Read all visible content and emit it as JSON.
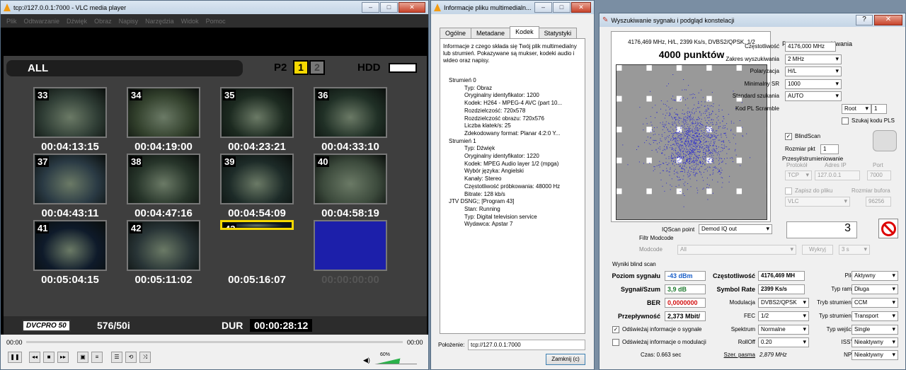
{
  "vlc": {
    "title": "tcp://127.0.0.1:7000 - VLC media player",
    "menu": [
      "Plik",
      "Odtwarzanie",
      "Dźwięk",
      "Obraz",
      "Napisy",
      "Narzędzia",
      "Widok",
      "Pomoc"
    ],
    "all_label": "ALL",
    "p2_label": "P2",
    "slot1": "1",
    "slot2": "2",
    "hdd_label": "HDD",
    "clips": [
      {
        "num": "33",
        "tc": "00:04:13:15"
      },
      {
        "num": "34",
        "tc": "00:04:19:00"
      },
      {
        "num": "35",
        "tc": "00:04:23:21"
      },
      {
        "num": "36",
        "tc": "00:04:33:10"
      },
      {
        "num": "37",
        "tc": "00:04:43:11"
      },
      {
        "num": "38",
        "tc": "00:04:47:16"
      },
      {
        "num": "39",
        "tc": "00:04:54:09"
      },
      {
        "num": "40",
        "tc": "00:04:58:19"
      },
      {
        "num": "41",
        "tc": "00:05:04:15"
      },
      {
        "num": "42",
        "tc": "00:05:11:02"
      },
      {
        "num": "43",
        "tc": "00:05:16:07"
      },
      {
        "num": "",
        "tc": "00:00:00:00"
      }
    ],
    "dvcpro": "DVCPRO 50",
    "format": "576/50i",
    "dur_label": "DUR",
    "dur_value": "00:00:28:12",
    "time_left": "00:00",
    "time_right": "00:00",
    "volume": "60%"
  },
  "info": {
    "title": "Informacje pliku multimedialn...",
    "tabs": [
      "Ogólne",
      "Metadane",
      "Kodek",
      "Statystyki"
    ],
    "active_tab": "Kodek",
    "desc": "Informacje z czego składa się Twój plik multimedialny lub strumień. Pokazywane są mukser, kodeki audio i wideo oraz napisy.",
    "tree": [
      {
        "t": "h",
        "v": "Strumień 0"
      },
      {
        "t": "c",
        "v": "Typ: Obraz"
      },
      {
        "t": "c",
        "v": "Oryginalny identyfikator: 1200"
      },
      {
        "t": "c",
        "v": "Kodek: H264 - MPEG-4 AVC (part 10..."
      },
      {
        "t": "c",
        "v": "Rozdzielczość: 720x578"
      },
      {
        "t": "c",
        "v": "Rozdzielczość obrazu: 720x576"
      },
      {
        "t": "c",
        "v": "Liczba klatek/s: 25"
      },
      {
        "t": "c",
        "v": "Zdekodowany format: Planar 4:2:0 Y..."
      },
      {
        "t": "h",
        "v": "Strumień 1"
      },
      {
        "t": "c",
        "v": "Typ: Dźwięk"
      },
      {
        "t": "c",
        "v": "Oryginalny identyfikator: 1220"
      },
      {
        "t": "c",
        "v": "Kodek: MPEG Audio layer 1/2 (mpga)"
      },
      {
        "t": "c",
        "v": "Wybór języka: Angielski"
      },
      {
        "t": "c",
        "v": "Kanały: Stereo"
      },
      {
        "t": "c",
        "v": "Częstotliwość próbkowania: 48000 Hz"
      },
      {
        "t": "c",
        "v": "Bitrate: 128 kb/s"
      },
      {
        "t": "h",
        "v": "JTV DSNG;; [Program 43]"
      },
      {
        "t": "c",
        "v": "Stan: Running"
      },
      {
        "t": "c",
        "v": "Typ: Digital television service"
      },
      {
        "t": "c",
        "v": "Wydawca: Apstar 7"
      }
    ],
    "loc_label": "Położenie:",
    "loc_value": "tcp://127.0.0.1:7000",
    "close_label": "Zamknij (c)"
  },
  "scan": {
    "title": "Wyszukiwanie sygnału i podgląd konstelacji",
    "help": "?",
    "const_sub": "4176,469 MHz, H/L, 2399 Ks/s, DVBS2/QPSK, 1/2",
    "const_points": "4000 punktów",
    "params_title": "Parametry wyszukiwania",
    "freq_label": "Częstotliwość",
    "freq_value": "4176,000 MHz",
    "range_label": "Zakres wyszukiwania",
    "range_value": "2 MHz",
    "pol_label": "Polaryzacja",
    "pol_value": "H/L",
    "minsr_label": "Minimalny SR",
    "minsr_value": "1000",
    "std_label": "Standard szukania",
    "std_value": "AUTO",
    "pls_label": "Kod PL Scramble",
    "pls_value": "Root",
    "pls_num": "1",
    "pls_search": "Szukaj kodu PLS",
    "blind_label": "BlindScan",
    "step_label": "Rozmiar pkt",
    "step_value": "1",
    "stream_title": "Przesył/strumieniowanie",
    "proto_label": "Protokół",
    "ip_label": "Adres IP",
    "port_label": "Port",
    "proto_value": "TCP",
    "ip_value": "127.0.0.1",
    "port_value": "7000",
    "save_label": "Zapisz do pliku",
    "buf_label": "Rozmiar bufora",
    "save_value": "VLC",
    "buf_value": "96256",
    "iq_label": "IQScan point",
    "iq_value": "Demod IQ out",
    "modcode_title": "Filtr Modcode",
    "modcode_label": "Modcode",
    "modcode_value": "All",
    "exclude_label": "Wykryj",
    "sec_value": "3 s",
    "result_value": "3",
    "results_title": "Wyniki blind scan",
    "level_label": "Poziom sygnału",
    "level_value": "-43 dBm",
    "snr_label": "Sygnał/Szum",
    "snr_value": "3,9 dB",
    "ber_label": "BER",
    "ber_value": "0,0000000",
    "thr_label": "Przepływność",
    "thr_value": "2,373 Mbit/",
    "rf_label": "Częstotliwość",
    "rf_value": "4176,469 MH",
    "sr_label": "Symbol Rate",
    "sr_value": "2399 Ks/s",
    "mod_label": "Modulacja",
    "mod_value": "DVBS2/QPSK",
    "fec_label": "FEC",
    "fec_value": "1/2",
    "spec_label": "Spektrum",
    "spec_value": "Normalne",
    "rolloff_label": "RollOff",
    "rolloff_value": "0.20",
    "bw_label": "Szer. pasma",
    "bw_value": "2,879 MHz",
    "pilot_label": "Pilot",
    "pilot_value": "Aktywny",
    "frame_label": "Typ ramki",
    "frame_value": "Długa",
    "smode_label": "Tryb strumienia",
    "smode_value": "CCM",
    "stype_label": "Typ strumienia",
    "stype_value": "Transport",
    "itype_label": "Typ wejścia",
    "itype_value": "Single",
    "issyi_label": "ISSYI",
    "issyi_value": "Nieaktywny",
    "npd_label": "NPD",
    "npd_value": "Nieaktywny",
    "refresh_sig": "Odświeżaj informacje o sygnale",
    "refresh_mod": "Odświeżaj informacje o modulacji",
    "time_label": "Czas: 0.663 sec"
  }
}
